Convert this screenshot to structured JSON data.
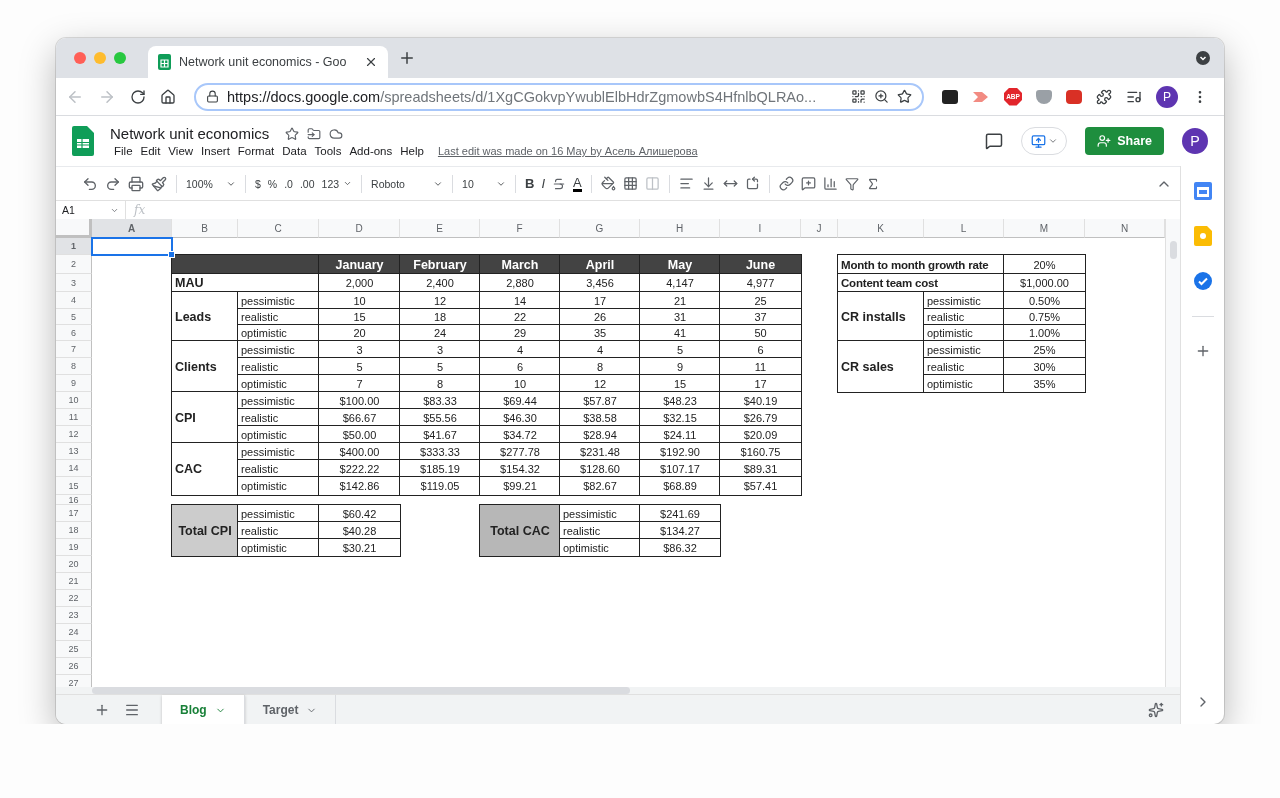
{
  "browser": {
    "tabs": [
      {
        "title": "Network unit economics - Goo",
        "selected": true
      }
    ],
    "url_host": "https://docs.google.com",
    "url_path": "/spreadsheets/d/1XgCGokvpYwublElbHdrZgmowbS4HfnlbQLRAo...",
    "adblock_label": "ABP",
    "avatar": "P"
  },
  "doc": {
    "title": "Network unit economics",
    "menus": [
      "File",
      "Edit",
      "View",
      "Insert",
      "Format",
      "Data",
      "Tools",
      "Add-ons",
      "Help"
    ],
    "last_edit": "Last edit was made on 16 May by Асель Алишерова",
    "share": "Share",
    "avatar": "P"
  },
  "toolbar": {
    "zoom": "100%",
    "currency": "$",
    "percent": "%",
    "decrease_decimals": ".0",
    "increase_decimals": ".00",
    "more_formats": "123",
    "font": "Roboto",
    "font_size": "10",
    "bold": "B",
    "italic": "I",
    "text_color": "A"
  },
  "name_box": "A1",
  "formula_label": "fx",
  "sheet": {
    "columns": [
      {
        "label": "A",
        "selected": true
      },
      {
        "label": "B",
        "selected": false
      },
      {
        "label": "C",
        "selected": false
      },
      {
        "label": "D",
        "selected": false
      },
      {
        "label": "E",
        "selected": false
      },
      {
        "label": "F",
        "selected": false
      },
      {
        "label": "G",
        "selected": false
      },
      {
        "label": "H",
        "selected": false
      },
      {
        "label": "I",
        "selected": false
      },
      {
        "label": "J",
        "selected": false
      },
      {
        "label": "K",
        "selected": false
      },
      {
        "label": "L",
        "selected": false
      },
      {
        "label": "M",
        "selected": false
      },
      {
        "label": "N",
        "selected": false
      }
    ],
    "rows": [
      {
        "label": "1",
        "selected": true
      },
      {
        "label": "2",
        "selected": false
      },
      {
        "label": "3",
        "selected": false
      },
      {
        "label": "4",
        "selected": false
      },
      {
        "label": "5",
        "selected": false
      },
      {
        "label": "6",
        "selected": false
      },
      {
        "label": "7",
        "selected": false
      },
      {
        "label": "8",
        "selected": false
      },
      {
        "label": "9",
        "selected": false
      },
      {
        "label": "10",
        "selected": false
      },
      {
        "label": "11",
        "selected": false
      },
      {
        "label": "12",
        "selected": false
      },
      {
        "label": "13",
        "selected": false
      },
      {
        "label": "14",
        "selected": false
      },
      {
        "label": "15",
        "selected": false
      },
      {
        "label": "16",
        "selected": false
      },
      {
        "label": "17",
        "selected": false
      },
      {
        "label": "18",
        "selected": false
      },
      {
        "label": "19",
        "selected": false
      },
      {
        "label": "20",
        "selected": false
      },
      {
        "label": "21",
        "selected": false
      },
      {
        "label": "22",
        "selected": false
      },
      {
        "label": "23",
        "selected": false
      },
      {
        "label": "24",
        "selected": false
      },
      {
        "label": "25",
        "selected": false
      },
      {
        "label": "26",
        "selected": false
      },
      {
        "label": "27",
        "selected": false
      }
    ]
  },
  "main_table": {
    "months": [
      "January",
      "February",
      "March",
      "April",
      "May",
      "June"
    ],
    "mau": {
      "label": "MAU",
      "values": [
        "2,000",
        "2,400",
        "2,880",
        "3,456",
        "4,147",
        "4,977"
      ]
    },
    "groups": [
      {
        "label": "Leads",
        "rows": [
          {
            "scenario": "pessimistic",
            "values": [
              "10",
              "12",
              "14",
              "17",
              "21",
              "25"
            ]
          },
          {
            "scenario": "realistic",
            "values": [
              "15",
              "18",
              "22",
              "26",
              "31",
              "37"
            ]
          },
          {
            "scenario": "optimistic",
            "values": [
              "20",
              "24",
              "29",
              "35",
              "41",
              "50"
            ]
          }
        ]
      },
      {
        "label": "Clients",
        "rows": [
          {
            "scenario": "pessimistic",
            "values": [
              "3",
              "3",
              "4",
              "4",
              "5",
              "6"
            ]
          },
          {
            "scenario": "realistic",
            "values": [
              "5",
              "5",
              "6",
              "8",
              "9",
              "11"
            ]
          },
          {
            "scenario": "optimistic",
            "values": [
              "7",
              "8",
              "10",
              "12",
              "15",
              "17"
            ]
          }
        ]
      },
      {
        "label": "CPI",
        "rows": [
          {
            "scenario": "pessimistic",
            "values": [
              "$100.00",
              "$83.33",
              "$69.44",
              "$57.87",
              "$48.23",
              "$40.19"
            ]
          },
          {
            "scenario": "realistic",
            "values": [
              "$66.67",
              "$55.56",
              "$46.30",
              "$38.58",
              "$32.15",
              "$26.79"
            ]
          },
          {
            "scenario": "optimistic",
            "values": [
              "$50.00",
              "$41.67",
              "$34.72",
              "$28.94",
              "$24.11",
              "$20.09"
            ]
          }
        ]
      },
      {
        "label": "CAC",
        "rows": [
          {
            "scenario": "pessimistic",
            "values": [
              "$400.00",
              "$333.33",
              "$277.78",
              "$231.48",
              "$192.90",
              "$160.75"
            ]
          },
          {
            "scenario": "realistic",
            "values": [
              "$222.22",
              "$185.19",
              "$154.32",
              "$128.60",
              "$107.17",
              "$89.31"
            ]
          },
          {
            "scenario": "optimistic",
            "values": [
              "$142.86",
              "$119.05",
              "$99.21",
              "$82.67",
              "$68.89",
              "$57.41"
            ]
          }
        ]
      }
    ]
  },
  "params_table": {
    "rows": [
      {
        "label": "Month to month growth rate",
        "value": "20%"
      },
      {
        "label": "Content team cost",
        "value": "$1,000.00"
      }
    ],
    "groups": [
      {
        "label": "CR installs",
        "rows": [
          {
            "scenario": "pessimistic",
            "value": "0.50%"
          },
          {
            "scenario": "realistic",
            "value": "0.75%"
          },
          {
            "scenario": "optimistic",
            "value": "1.00%"
          }
        ]
      },
      {
        "label": "CR sales",
        "rows": [
          {
            "scenario": "pessimistic",
            "value": "25%"
          },
          {
            "scenario": "realistic",
            "value": "30%"
          },
          {
            "scenario": "optimistic",
            "value": "35%"
          }
        ]
      }
    ]
  },
  "totals": [
    {
      "label": "Total CPI",
      "color": "#cccccc",
      "rows": [
        {
          "scenario": "pessimistic",
          "value": "$60.42"
        },
        {
          "scenario": "realistic",
          "value": "$40.28"
        },
        {
          "scenario": "optimistic",
          "value": "$30.21"
        }
      ]
    },
    {
      "label": "Total CAC",
      "color": "#b7b7b7",
      "rows": [
        {
          "scenario": "pessimistic",
          "value": "$241.69"
        },
        {
          "scenario": "realistic",
          "value": "$134.27"
        },
        {
          "scenario": "optimistic",
          "value": "$86.32"
        }
      ]
    }
  ],
  "sheet_tabs": [
    {
      "label": "Blog",
      "selected": true
    },
    {
      "label": "Target",
      "selected": false
    }
  ]
}
